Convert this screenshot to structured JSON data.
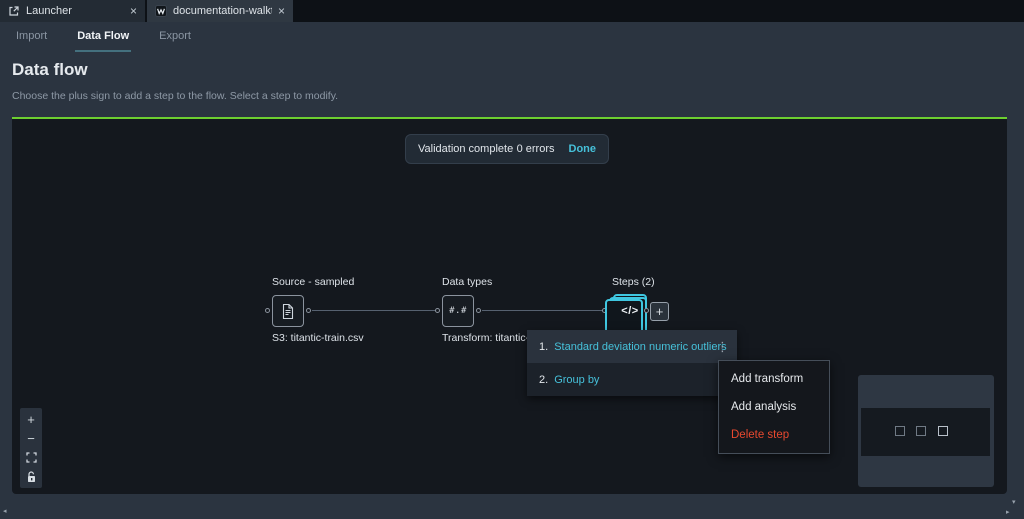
{
  "window_tabs": [
    {
      "label": "Launcher",
      "icon": "launcher-icon",
      "close": "×"
    },
    {
      "label": "documentation-walkthrough-",
      "icon": "data-wrangler-icon",
      "close": "×",
      "active": true
    }
  ],
  "nav": {
    "items": [
      {
        "label": "Import",
        "active": false
      },
      {
        "label": "Data Flow",
        "active": true
      },
      {
        "label": "Export",
        "active": false
      }
    ]
  },
  "header": {
    "title": "Data flow",
    "description": "Choose the plus sign to add a step to the flow. Select a step to modify."
  },
  "validation_banner": {
    "message": "Validation complete",
    "errors": "0 errors",
    "action": "Done"
  },
  "flow": {
    "nodes": [
      {
        "title": "Source - sampled",
        "icon": "file-icon",
        "icon_text": "",
        "subtitle": "S3: titantic-train.csv",
        "selected": false
      },
      {
        "title": "Data types",
        "icon": "numeric-icon",
        "icon_text": "#.#",
        "subtitle": "Transform: titantic-t",
        "selected": false
      },
      {
        "title": "Steps (2)",
        "icon": "code-icon",
        "icon_text": "</>",
        "subtitle": "",
        "selected": true
      }
    ],
    "add_step_button": "+"
  },
  "steps_list": {
    "items": [
      {
        "number": "1.",
        "label": "Standard deviation numeric outliers",
        "menu_icon": "⋮"
      },
      {
        "number": "2.",
        "label": "Group by",
        "menu_icon": "⋮"
      }
    ]
  },
  "context_menu": {
    "items": [
      {
        "label": "Add transform",
        "danger": false
      },
      {
        "label": "Add analysis",
        "danger": false
      },
      {
        "label": "Delete step",
        "danger": true
      }
    ]
  },
  "canvas_controls": {
    "zoom_in": "+",
    "zoom_out": "−",
    "fit": "fit-view-icon",
    "lock": "unlock-icon"
  },
  "scrollbars": {
    "left": "◂",
    "right": "▸",
    "down": "▾"
  },
  "colors": {
    "accent_cyan": "#46c1da",
    "selected_node_border": "#3fc6e0",
    "validation_green": "#6dcf30",
    "danger_red": "#e8492f",
    "canvas_bg": "#14181e",
    "panel_bg": "#2b3440"
  }
}
